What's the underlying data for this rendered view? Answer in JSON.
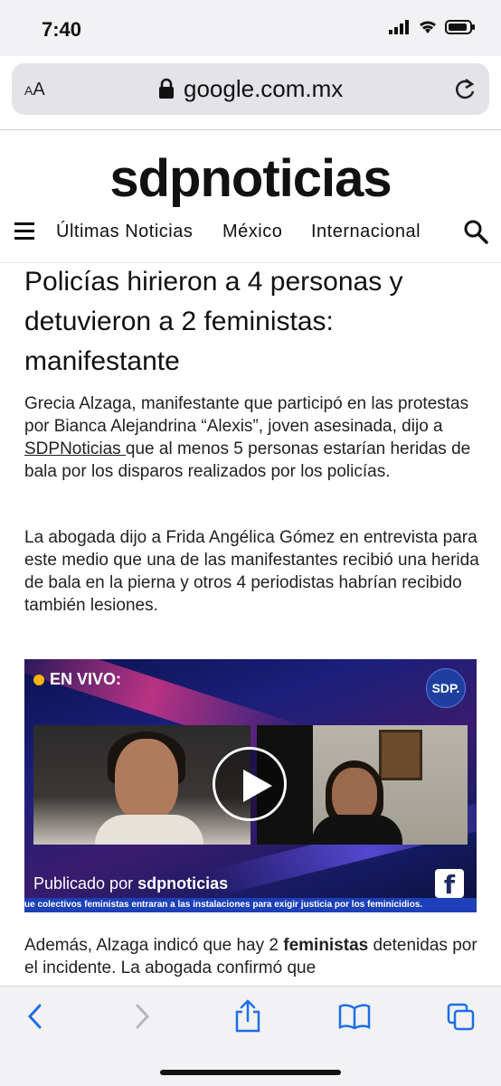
{
  "status_bar": {
    "time": "7:40"
  },
  "browser": {
    "text_size_label": "AA",
    "url": "google.com.mx"
  },
  "site": {
    "logo": "sdpnoticias",
    "nav": [
      "Últimas Noticias",
      "México",
      "Internacional"
    ]
  },
  "article": {
    "headline": "Policías hirieron a 4 personas y detuvieron a 2 feministas: manifestante",
    "p1_before": "Grecia Alzaga, manifestante que participó en las protestas por Bianca Alejandrina “Alexis”, joven asesinada, dijo a ",
    "p1_link": "SDPNoticias ",
    "p1_after": "que al menos 5 personas estarían heridas de bala por los disparos realizados por los policías.",
    "p2": "La abogada dijo a Frida Angélica Gómez en entrevista para este medio que una de las manifestantes recibió una herida de bala en la pierna y otros 4 periodistas habrían recibido también lesiones.",
    "p3_before": "Además, Alzaga indicó que hay 2 ",
    "p3_bold": "feministas",
    "p3_after": " detenidas por el incidente. La abogada confirmó que"
  },
  "video": {
    "live_label": "EN VIVO:",
    "badge": "SDP.",
    "published_prefix": "Publicado por ",
    "publisher": "sdpnoticias",
    "ticker": "ue colectivos feministas entraran a las instalaciones para exigir justicia por los feminicidios."
  },
  "toolbar": {
    "back_icon": "chevron-left-icon",
    "forward_icon": "chevron-right-icon",
    "share_icon": "share-icon",
    "bookmarks_icon": "book-icon",
    "tabs_icon": "tabs-icon"
  }
}
